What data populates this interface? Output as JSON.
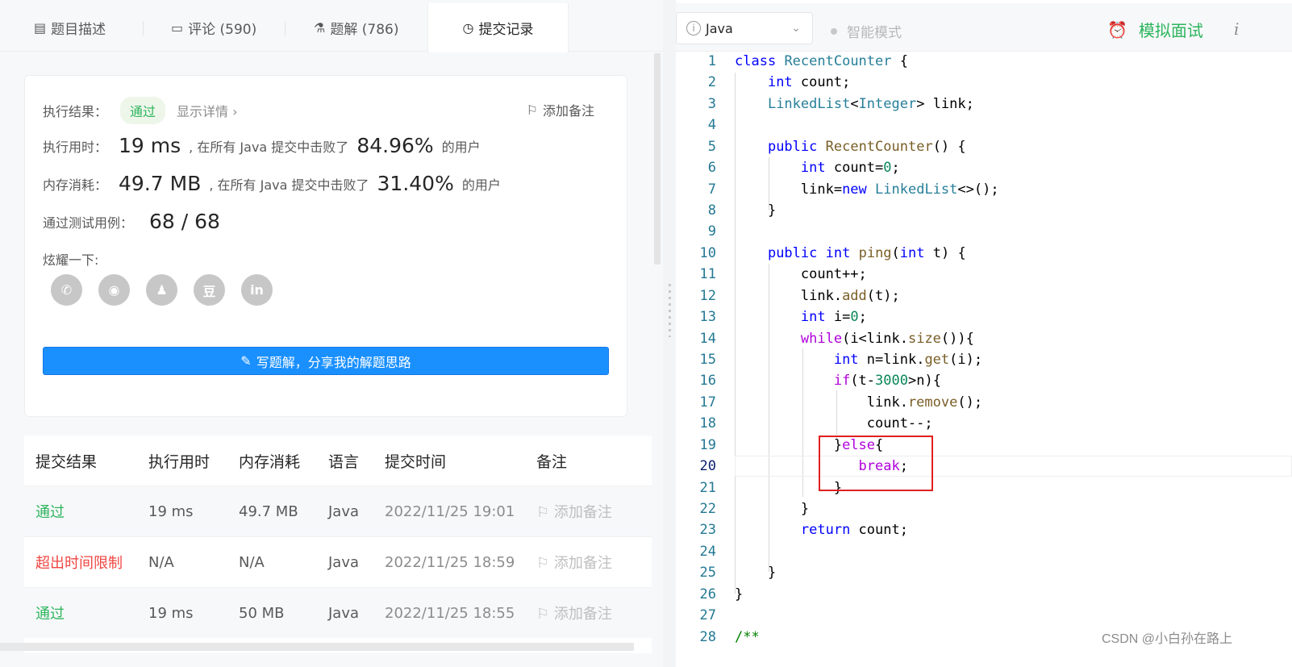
{
  "tabs": [
    {
      "icon": "description-icon",
      "label": "题目描述"
    },
    {
      "icon": "comment-icon",
      "label": "评论 (590)"
    },
    {
      "icon": "flask-icon",
      "label": "题解 (786)"
    },
    {
      "icon": "clock-icon",
      "label": "提交记录"
    }
  ],
  "result": {
    "result_label": "执行结果：",
    "status": "通过",
    "detail_link": "显示详情 ›",
    "add_note": "添加备注",
    "time_label": "执行用时：",
    "time_value": "19 ms",
    "time_mid": ", 在所有 Java 提交中击败了",
    "time_pct": "84.96%",
    "suffix": "的用户",
    "mem_label": "内存消耗：",
    "mem_value": "49.7 MB",
    "mem_mid": ", 在所有 Java 提交中击败了",
    "mem_pct": "31.40%",
    "tests_label": "通过测试用例：",
    "tests_value": "68 / 68",
    "share_label": "炫耀一下:",
    "share_icons": [
      "wechat-icon",
      "weibo-icon",
      "qq-icon",
      "douban-icon",
      "linkedin-icon"
    ],
    "share_glyphs": [
      "✆",
      "◉",
      "♟",
      "豆",
      "in"
    ],
    "write_button": "写题解，分享我的解题思路"
  },
  "submissions": {
    "headers": [
      "提交结果",
      "执行用时",
      "内存消耗",
      "语言",
      "提交时间",
      "备注"
    ],
    "rows": [
      {
        "result": "通过",
        "time": "19 ms",
        "memory": "49.7 MB",
        "lang": "Java",
        "submitted": "2022/11/25 19:01",
        "note": "添加备注"
      },
      {
        "result": "超出时间限制",
        "time": "N/A",
        "memory": "N/A",
        "lang": "Java",
        "submitted": "2022/11/25 18:59",
        "note": "添加备注"
      },
      {
        "result": "通过",
        "time": "19 ms",
        "memory": "50 MB",
        "lang": "Java",
        "submitted": "2022/11/25 18:55",
        "note": "添加备注"
      }
    ]
  },
  "editor_toolbar": {
    "language": "Java",
    "smart_mode": "智能模式",
    "mock_interview": "模拟面试",
    "info": "i"
  },
  "watermark": "CSDN @小白孙在路上",
  "colors": {
    "accent": "#1a90ff",
    "success": "#2db55d",
    "error": "#ef4743",
    "highlight_box": "#e01f1f"
  }
}
